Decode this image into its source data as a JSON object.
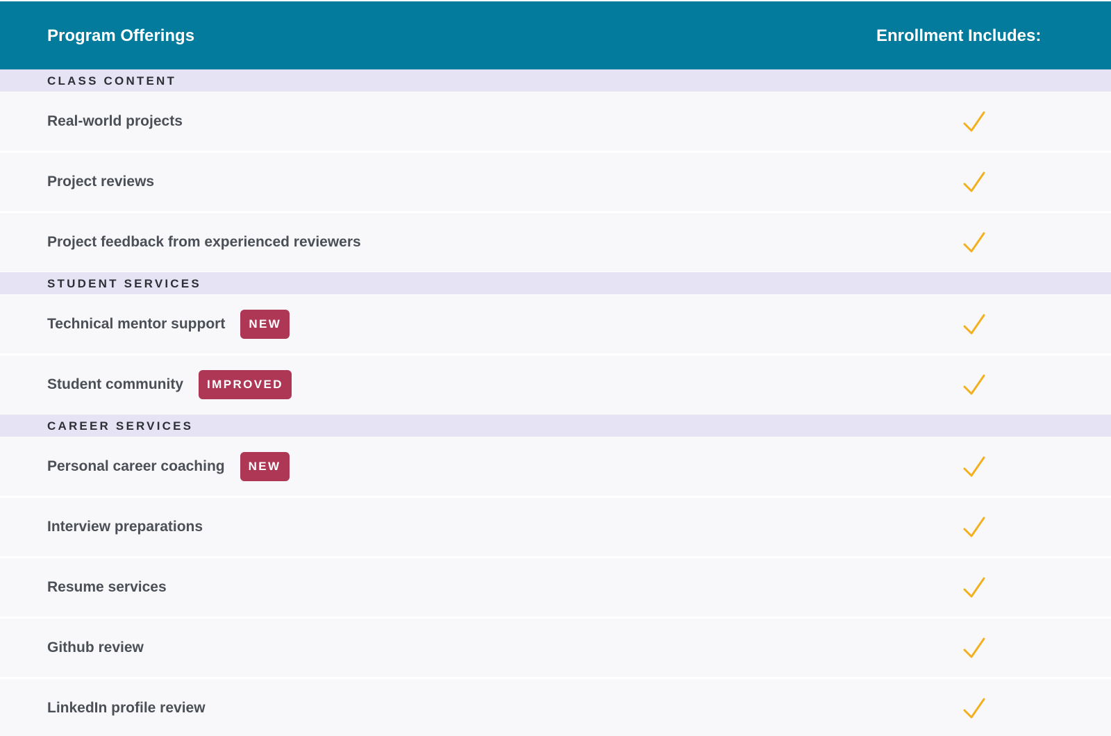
{
  "header": {
    "left_title": "Program Offerings",
    "right_title": "Enrollment Includes:"
  },
  "colors": {
    "header_bg": "#027b9d",
    "section_bg": "#e6e4f4",
    "row_bg": "#f8f8fb",
    "badge_bg": "#ad3755",
    "check": "#f2b01e"
  },
  "sections": [
    {
      "title": "CLASS CONTENT",
      "rows": [
        {
          "label": "Real-world projects",
          "badge": "",
          "included": true,
          "icon": "checkmark-icon"
        },
        {
          "label": "Project reviews",
          "badge": "",
          "included": true,
          "icon": "checkmark-icon"
        },
        {
          "label": "Project feedback from experienced reviewers",
          "badge": "",
          "included": true,
          "icon": "checkmark-icon"
        }
      ]
    },
    {
      "title": "STUDENT SERVICES",
      "rows": [
        {
          "label": "Technical mentor support",
          "badge": "NEW",
          "included": true,
          "icon": "checkmark-icon"
        },
        {
          "label": "Student community",
          "badge": "IMPROVED",
          "included": true,
          "icon": "checkmark-icon"
        }
      ]
    },
    {
      "title": "CAREER SERVICES",
      "rows": [
        {
          "label": "Personal career coaching",
          "badge": "NEW",
          "included": true,
          "icon": "checkmark-icon"
        },
        {
          "label": "Interview preparations",
          "badge": "",
          "included": true,
          "icon": "checkmark-icon"
        },
        {
          "label": "Resume services",
          "badge": "",
          "included": true,
          "icon": "checkmark-icon"
        },
        {
          "label": "Github review",
          "badge": "",
          "included": true,
          "icon": "checkmark-icon"
        },
        {
          "label": "LinkedIn profile review",
          "badge": "",
          "included": true,
          "icon": "checkmark-icon"
        }
      ]
    }
  ]
}
